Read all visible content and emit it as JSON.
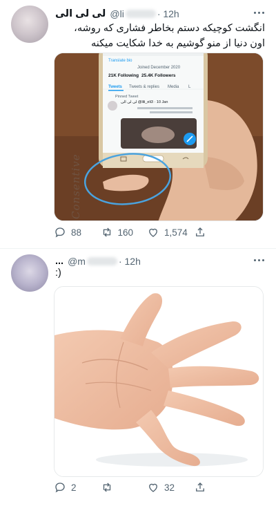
{
  "tweets": [
    {
      "display_name": "لی لی الی",
      "handle_prefix": "@li",
      "time": "· 12h",
      "text": "انگشت کوچیکه دستم بخاطر فشاری که روشه، اون دنیا از منو گوشیم به خدا شکایت میکنه",
      "media": {
        "phone_stats_following": "21K Following",
        "phone_stats_followers": "25.4K Followers",
        "phone_joined": "Joined December 2020",
        "phone_tabs": [
          "Tweets",
          "Tweets & replies",
          "Media",
          "L"
        ],
        "phone_pinned": "Pinned Tweet",
        "phone_tweet_user": "لی لی الی @lili_eli3 · 10 Jan",
        "phone_translate": "Translate bio",
        "watermark": "Consentive"
      },
      "replies": "88",
      "retweets": "160",
      "likes": "1,574"
    },
    {
      "display_name": "...",
      "handle_prefix": "@m",
      "time": "· 12h",
      "text": ":)",
      "replies": "2",
      "retweets": "",
      "likes": "32"
    }
  ],
  "colors": {
    "text_primary": "#0f1419",
    "text_secondary": "#536471",
    "circle_annotation": "#4aa3df"
  }
}
